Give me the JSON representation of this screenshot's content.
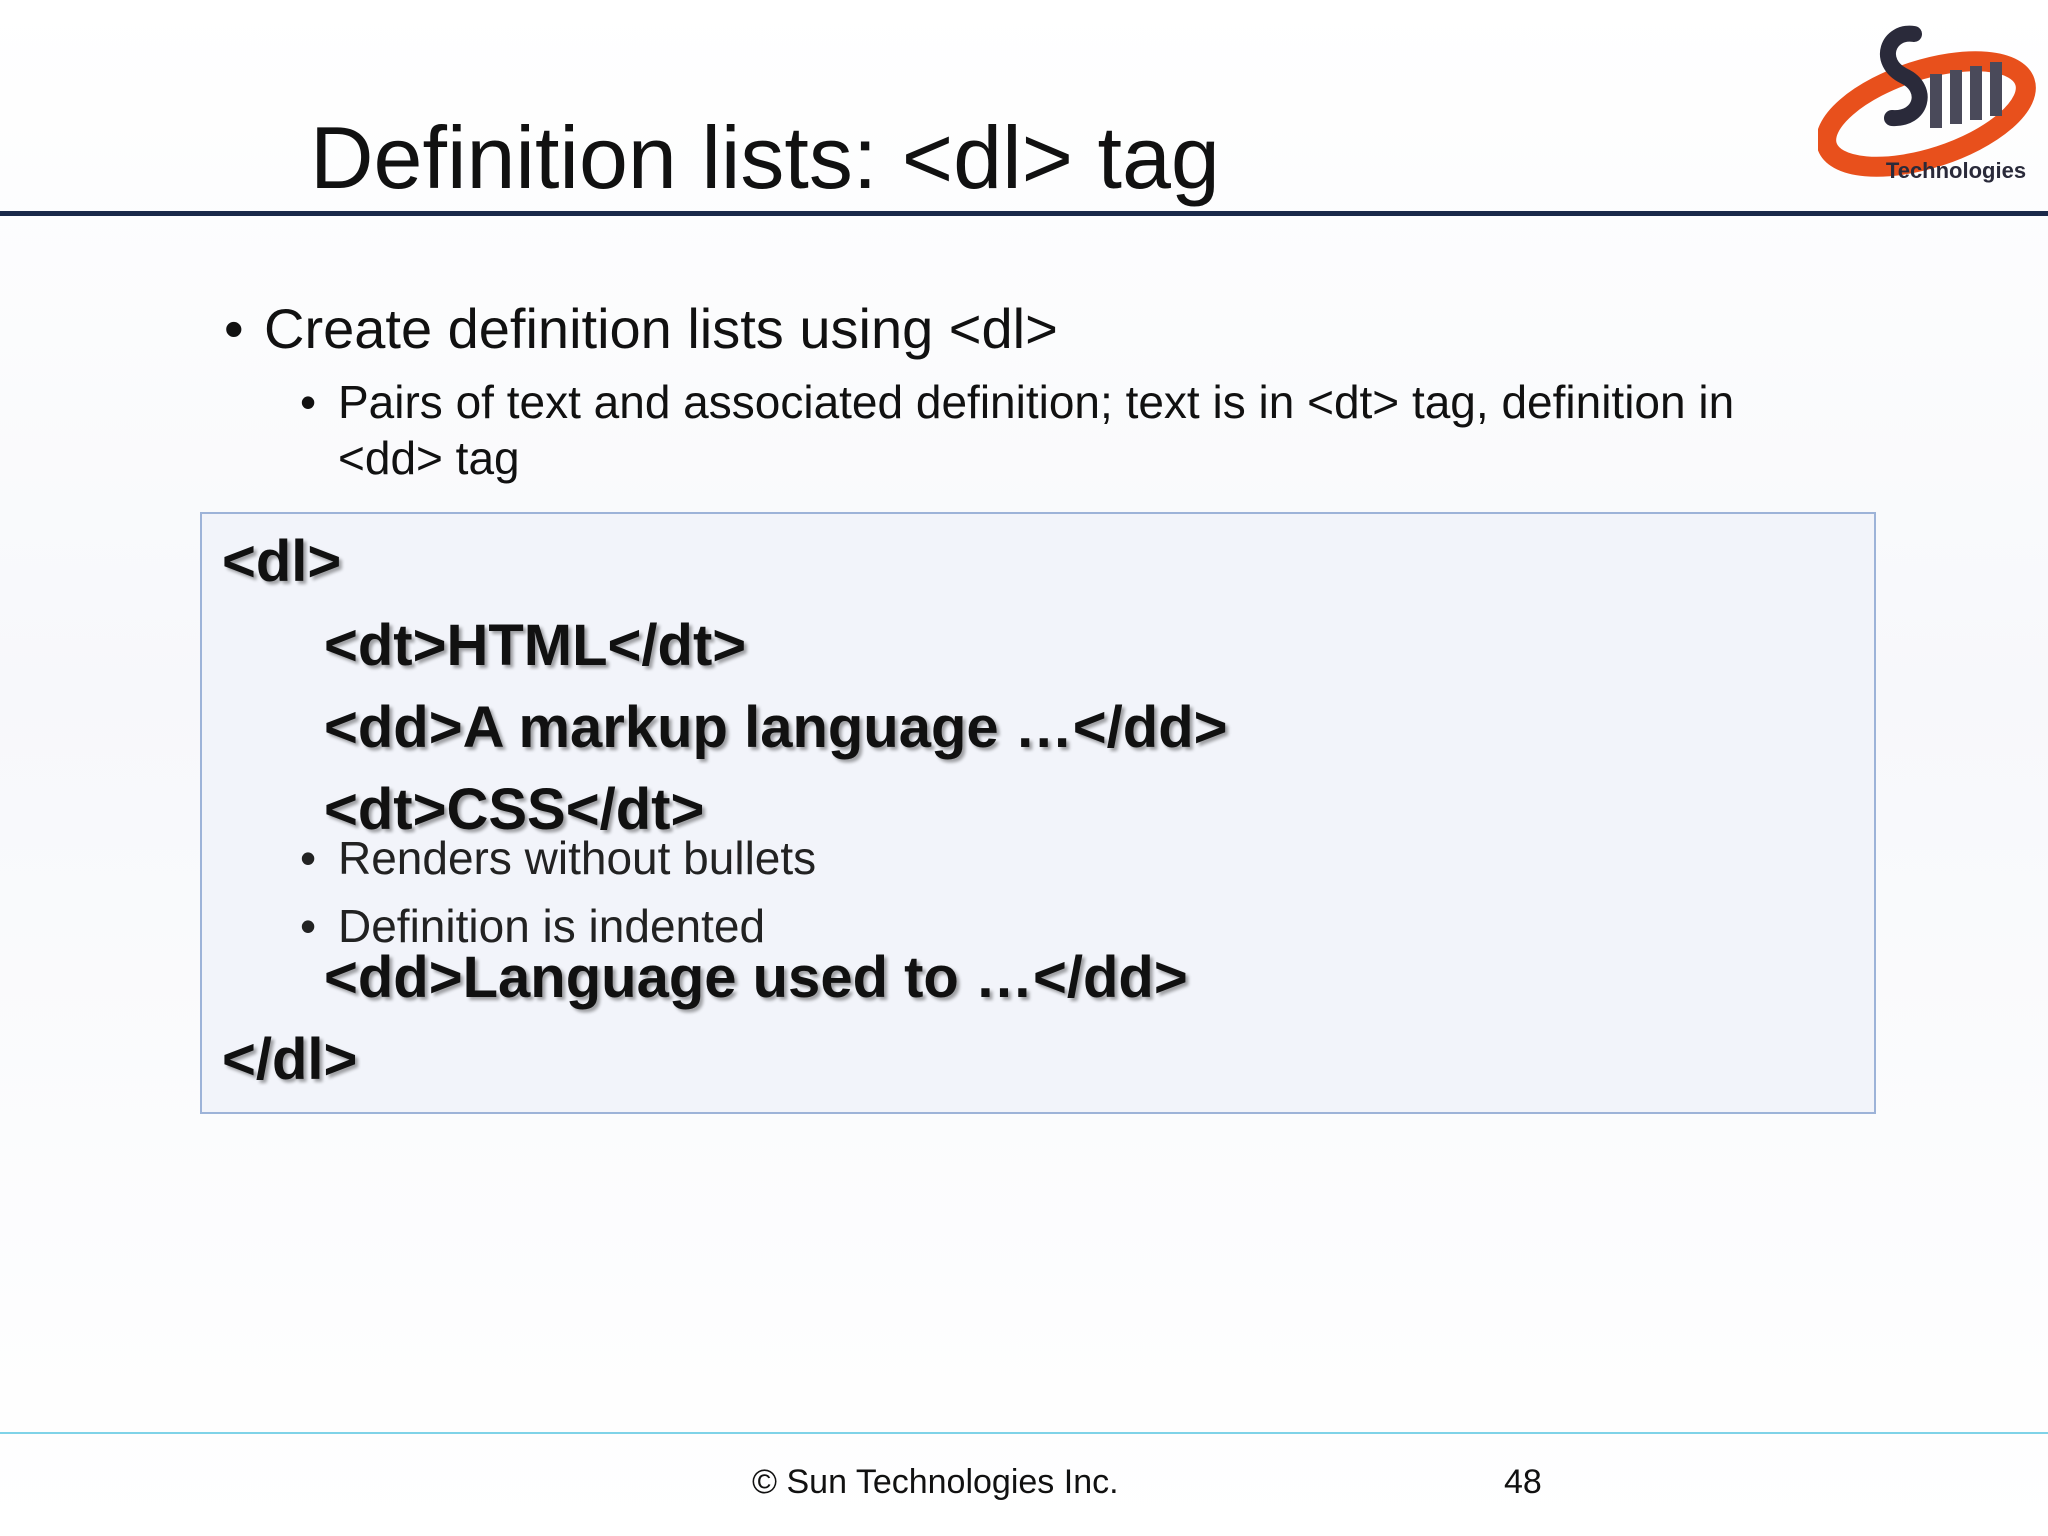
{
  "slide": {
    "title": "Definition lists: <dl> tag",
    "logo_text": "Technologies",
    "bullets": [
      {
        "symbol": "•",
        "text": "Create definition lists using <dl>"
      },
      {
        "symbol": "•",
        "text": "Pairs of text and associated definition; text is in <dt> tag, definition in <dd> tag"
      },
      {
        "symbol": "•",
        "text": "Renders without bullets"
      },
      {
        "symbol": "•",
        "text": "Definition is indented"
      }
    ],
    "code_lines": [
      "<dl>",
      "<dt>HTML</dt>",
      "<dd>A markup language …</dd>",
      "<dt>CSS</dt>",
      "<dd>Language used to …</dd>",
      "</dl>"
    ]
  },
  "footer": {
    "copyright": "© Sun Technologies Inc.",
    "page_number": "48"
  },
  "colors": {
    "title_rule": "#1a2a4a",
    "code_box_border": "#9db3d8",
    "code_box_fill": "#f2f4fa",
    "footer_rule": "#7fd3e8",
    "logo_orange": "#e8501c"
  }
}
